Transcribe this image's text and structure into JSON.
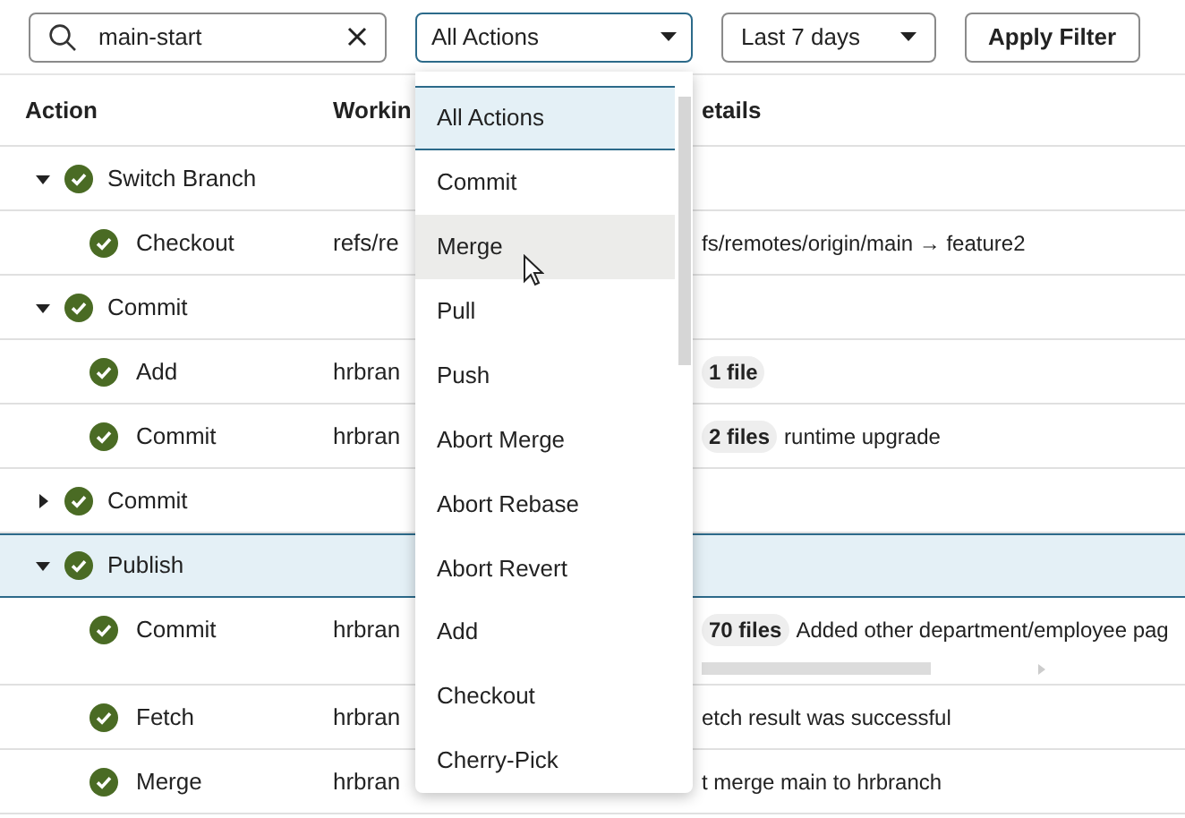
{
  "filters": {
    "search": {
      "value": "main-start"
    },
    "action_filter": {
      "value": "All Actions"
    },
    "date_filter": {
      "value": "Last 7 days"
    },
    "apply_button": "Apply Filter"
  },
  "table": {
    "columns": [
      "Action",
      "Workin",
      "etails"
    ],
    "rows": [
      {
        "action": "Switch Branch",
        "expanded": true,
        "selected": false,
        "children": [
          {
            "action": "Checkout",
            "working": "refs/re",
            "details": "fs/remotes/origin/main → feature2"
          }
        ]
      },
      {
        "action": "Commit",
        "expanded": true,
        "selected": false,
        "children": [
          {
            "action": "Add",
            "working": "hrbran",
            "badge": "1 file"
          },
          {
            "action": "Commit",
            "working": "hrbran",
            "badge": "2 files",
            "details": "runtime upgrade"
          }
        ]
      },
      {
        "action": "Commit",
        "expanded": false,
        "selected": false
      },
      {
        "action": "Publish",
        "expanded": true,
        "selected": true,
        "children": [
          {
            "action": "Commit",
            "working": "hrbran",
            "badge": "70 files",
            "details": "Added other department/employee pag",
            "scrollable": true
          },
          {
            "action": "Fetch",
            "working": "hrbran",
            "details": "etch result was successful"
          },
          {
            "action": "Merge",
            "working": "hrbran",
            "details": "t merge main to hrbranch"
          }
        ]
      }
    ]
  },
  "action_menu": {
    "options": [
      {
        "label": "All Actions",
        "selected": true,
        "hovered": false
      },
      {
        "label": "Commit",
        "selected": false,
        "hovered": false
      },
      {
        "label": "Merge",
        "selected": false,
        "hovered": true
      },
      {
        "label": "Pull",
        "selected": false,
        "hovered": false
      },
      {
        "label": "Push",
        "selected": false,
        "hovered": false
      },
      {
        "label": "Abort Merge",
        "selected": false,
        "hovered": false
      },
      {
        "label": "Abort Rebase",
        "selected": false,
        "hovered": false
      },
      {
        "label": "Abort Revert",
        "selected": false,
        "hovered": false
      },
      {
        "label": "Add",
        "selected": false,
        "hovered": false
      },
      {
        "label": "Checkout",
        "selected": false,
        "hovered": false
      },
      {
        "label": "Cherry-Pick",
        "selected": false,
        "hovered": false
      }
    ]
  }
}
